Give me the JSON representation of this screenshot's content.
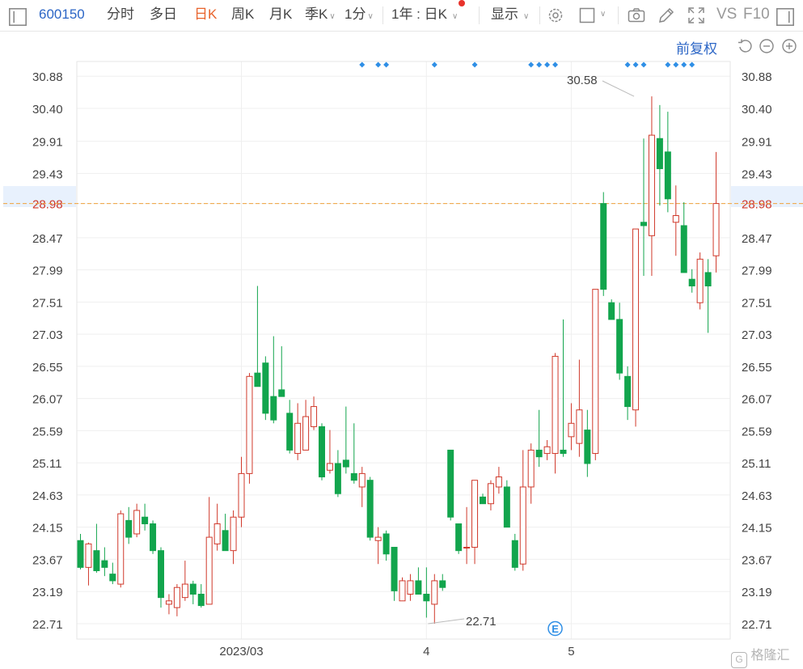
{
  "toolbar": {
    "code": "600150",
    "items": [
      "分时",
      "多日",
      "日K",
      "周K",
      "月K",
      "季K",
      "1分"
    ],
    "active": "日K",
    "range_select": "1年 : 日K",
    "display_label": "显示",
    "vs": "VS",
    "f10": "F10"
  },
  "subbar": {
    "adjust": "前复权"
  },
  "watermark": "格隆汇",
  "colors": {
    "up": "#d0392b",
    "down": "#12a54d",
    "current_line": "#f0a23b",
    "current_bg": "#e8f1fd",
    "marker": "#2f8fe6"
  },
  "chart_data": {
    "type": "candlestick",
    "ylim": [
      22.48,
      31.1
    ],
    "y_ticks": [
      "30.88",
      "30.40",
      "29.91",
      "29.43",
      "28.98",
      "28.47",
      "27.99",
      "27.51",
      "27.03",
      "26.55",
      "26.07",
      "25.59",
      "25.11",
      "24.63",
      "24.15",
      "23.67",
      "23.19",
      "22.71"
    ],
    "highlight_tick": "28.98",
    "current_price": 28.98,
    "x_labels": [
      {
        "label": "2023/03",
        "index": 20
      },
      {
        "label": "4",
        "index": 43
      },
      {
        "label": "5",
        "index": 61
      }
    ],
    "annotations": [
      {
        "text": "30.58",
        "index": 69,
        "value": 30.58,
        "type": "high"
      },
      {
        "text": "22.71",
        "index": 43,
        "value": 22.71,
        "type": "low"
      }
    ],
    "event_badge": {
      "text": "E",
      "index": 59
    },
    "markers": [
      35,
      37,
      38,
      44,
      49,
      56,
      57,
      58,
      59,
      68,
      69,
      70,
      73,
      74,
      75,
      76
    ],
    "candles": [
      {
        "o": 23.95,
        "h": 24.05,
        "l": 23.52,
        "c": 23.55
      },
      {
        "o": 23.55,
        "h": 23.92,
        "l": 23.28,
        "c": 23.9
      },
      {
        "o": 23.8,
        "h": 24.2,
        "l": 23.47,
        "c": 23.5
      },
      {
        "o": 23.65,
        "h": 23.85,
        "l": 23.42,
        "c": 23.55
      },
      {
        "o": 23.45,
        "h": 23.62,
        "l": 23.3,
        "c": 23.35
      },
      {
        "o": 23.3,
        "h": 24.4,
        "l": 23.25,
        "c": 24.35
      },
      {
        "o": 24.25,
        "h": 24.45,
        "l": 23.9,
        "c": 24.0
      },
      {
        "o": 24.05,
        "h": 24.5,
        "l": 24.0,
        "c": 24.4
      },
      {
        "o": 24.3,
        "h": 24.5,
        "l": 24.1,
        "c": 24.2
      },
      {
        "o": 24.2,
        "h": 24.25,
        "l": 23.75,
        "c": 23.8
      },
      {
        "o": 23.8,
        "h": 23.85,
        "l": 22.95,
        "c": 23.1
      },
      {
        "o": 23.0,
        "h": 23.15,
        "l": 22.85,
        "c": 23.05
      },
      {
        "o": 22.95,
        "h": 23.3,
        "l": 22.82,
        "c": 23.25
      },
      {
        "o": 23.1,
        "h": 23.65,
        "l": 23.05,
        "c": 23.3
      },
      {
        "o": 23.3,
        "h": 23.35,
        "l": 23.0,
        "c": 23.15
      },
      {
        "o": 23.15,
        "h": 23.3,
        "l": 22.95,
        "c": 22.98
      },
      {
        "o": 23.0,
        "h": 24.6,
        "l": 23.0,
        "c": 24.0
      },
      {
        "o": 23.9,
        "h": 24.5,
        "l": 23.8,
        "c": 24.2
      },
      {
        "o": 24.1,
        "h": 24.35,
        "l": 23.8,
        "c": 23.8
      },
      {
        "o": 23.8,
        "h": 24.4,
        "l": 23.6,
        "c": 24.3
      },
      {
        "o": 24.3,
        "h": 25.2,
        "l": 24.15,
        "c": 24.95
      },
      {
        "o": 24.95,
        "h": 26.45,
        "l": 24.8,
        "c": 26.4
      },
      {
        "o": 26.45,
        "h": 27.75,
        "l": 26.3,
        "c": 26.25
      },
      {
        "o": 26.6,
        "h": 26.7,
        "l": 25.75,
        "c": 25.85
      },
      {
        "o": 26.1,
        "h": 27.0,
        "l": 25.7,
        "c": 25.75
      },
      {
        "o": 26.2,
        "h": 26.85,
        "l": 26.1,
        "c": 26.1
      },
      {
        "o": 25.85,
        "h": 26.05,
        "l": 25.25,
        "c": 25.3
      },
      {
        "o": 25.25,
        "h": 26.0,
        "l": 25.15,
        "c": 25.7
      },
      {
        "o": 25.3,
        "h": 26.05,
        "l": 25.3,
        "c": 25.8
      },
      {
        "o": 25.65,
        "h": 26.1,
        "l": 25.6,
        "c": 25.95
      },
      {
        "o": 25.65,
        "h": 25.7,
        "l": 24.85,
        "c": 24.9
      },
      {
        "o": 25.0,
        "h": 25.6,
        "l": 24.95,
        "c": 25.1
      },
      {
        "o": 25.1,
        "h": 25.3,
        "l": 24.6,
        "c": 24.65
      },
      {
        "o": 25.15,
        "h": 25.95,
        "l": 24.95,
        "c": 25.05
      },
      {
        "o": 24.95,
        "h": 25.7,
        "l": 24.8,
        "c": 24.85
      },
      {
        "o": 24.75,
        "h": 25.05,
        "l": 24.45,
        "c": 24.95
      },
      {
        "o": 24.85,
        "h": 24.9,
        "l": 23.95,
        "c": 24.0
      },
      {
        "o": 23.95,
        "h": 24.15,
        "l": 23.6,
        "c": 24.0
      },
      {
        "o": 24.05,
        "h": 24.1,
        "l": 23.65,
        "c": 23.75
      },
      {
        "o": 23.85,
        "h": 23.85,
        "l": 23.05,
        "c": 23.2
      },
      {
        "o": 23.05,
        "h": 23.4,
        "l": 23.05,
        "c": 23.35
      },
      {
        "o": 23.15,
        "h": 23.45,
        "l": 23.05,
        "c": 23.35
      },
      {
        "o": 23.35,
        "h": 23.55,
        "l": 23.15,
        "c": 23.15
      },
      {
        "o": 23.15,
        "h": 23.55,
        "l": 22.8,
        "c": 23.05
      },
      {
        "o": 23.0,
        "h": 23.45,
        "l": 22.71,
        "c": 23.35
      },
      {
        "o": 23.35,
        "h": 23.45,
        "l": 23.2,
        "c": 23.25
      },
      {
        "o": 25.3,
        "h": 25.3,
        "l": 24.25,
        "c": 24.3
      },
      {
        "o": 24.2,
        "h": 24.2,
        "l": 23.75,
        "c": 23.8
      },
      {
        "o": 23.85,
        "h": 24.45,
        "l": 23.6,
        "c": 23.85
      },
      {
        "o": 23.85,
        "h": 24.85,
        "l": 23.6,
        "c": 24.85
      },
      {
        "o": 24.6,
        "h": 24.65,
        "l": 24.5,
        "c": 24.5
      },
      {
        "o": 24.5,
        "h": 24.85,
        "l": 24.4,
        "c": 24.8
      },
      {
        "o": 24.75,
        "h": 25.05,
        "l": 24.65,
        "c": 24.9
      },
      {
        "o": 24.75,
        "h": 24.85,
        "l": 24.15,
        "c": 24.15
      },
      {
        "o": 23.95,
        "h": 24.05,
        "l": 23.5,
        "c": 23.55
      },
      {
        "o": 23.6,
        "h": 25.3,
        "l": 23.5,
        "c": 24.75
      },
      {
        "o": 24.75,
        "h": 25.4,
        "l": 24.5,
        "c": 25.3
      },
      {
        "o": 25.3,
        "h": 25.9,
        "l": 25.05,
        "c": 25.2
      },
      {
        "o": 25.25,
        "h": 25.45,
        "l": 25.15,
        "c": 25.35
      },
      {
        "o": 25.25,
        "h": 26.75,
        "l": 24.95,
        "c": 26.7
      },
      {
        "o": 25.3,
        "h": 27.25,
        "l": 25.2,
        "c": 25.25
      },
      {
        "o": 25.5,
        "h": 26.0,
        "l": 25.3,
        "c": 25.7
      },
      {
        "o": 25.4,
        "h": 26.65,
        "l": 25.2,
        "c": 25.9
      },
      {
        "o": 25.6,
        "h": 25.9,
        "l": 24.9,
        "c": 25.1
      },
      {
        "o": 25.25,
        "h": 27.7,
        "l": 25.15,
        "c": 27.7
      },
      {
        "o": 28.98,
        "h": 29.15,
        "l": 27.6,
        "c": 27.7
      },
      {
        "o": 27.5,
        "h": 27.55,
        "l": 27.3,
        "c": 27.25
      },
      {
        "o": 27.25,
        "h": 27.5,
        "l": 26.35,
        "c": 26.45
      },
      {
        "o": 26.4,
        "h": 26.55,
        "l": 25.75,
        "c": 25.95
      },
      {
        "o": 25.9,
        "h": 28.6,
        "l": 25.65,
        "c": 28.6
      },
      {
        "o": 28.7,
        "h": 29.95,
        "l": 27.9,
        "c": 28.65
      },
      {
        "o": 28.5,
        "h": 30.58,
        "l": 27.9,
        "c": 30.0
      },
      {
        "o": 29.95,
        "h": 30.45,
        "l": 28.95,
        "c": 29.5
      },
      {
        "o": 29.75,
        "h": 30.35,
        "l": 28.85,
        "c": 29.05
      },
      {
        "o": 28.7,
        "h": 29.25,
        "l": 28.2,
        "c": 28.8
      },
      {
        "o": 28.65,
        "h": 29.0,
        "l": 27.95,
        "c": 27.95
      },
      {
        "o": 27.85,
        "h": 28.0,
        "l": 27.65,
        "c": 27.75
      },
      {
        "o": 27.5,
        "h": 28.25,
        "l": 27.4,
        "c": 28.15
      },
      {
        "o": 27.95,
        "h": 28.15,
        "l": 27.05,
        "c": 27.75
      },
      {
        "o": 28.2,
        "h": 29.75,
        "l": 27.95,
        "c": 28.98
      }
    ]
  }
}
